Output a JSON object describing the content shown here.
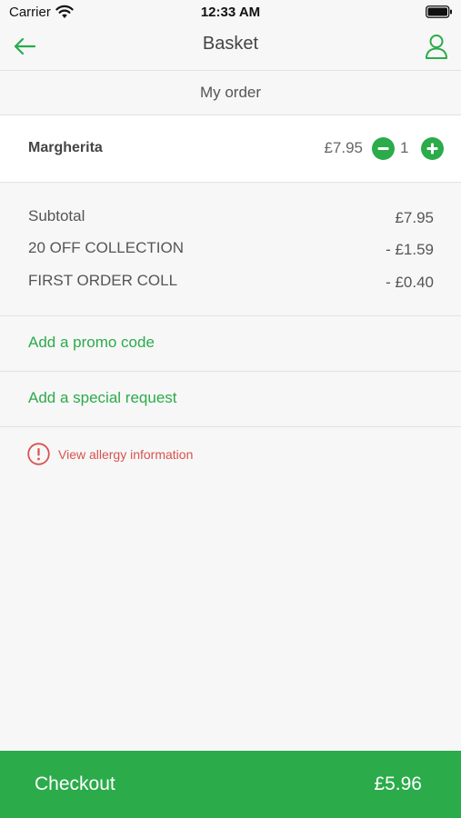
{
  "status_bar": {
    "carrier": "Carrier",
    "time": "12:33 AM"
  },
  "nav": {
    "title": "Basket",
    "back_icon": "arrow-left-icon",
    "profile_icon": "user-icon"
  },
  "section": {
    "header": "My order"
  },
  "basket": {
    "items": [
      {
        "name": "Margherita",
        "price": "£7.95",
        "quantity": "1"
      }
    ]
  },
  "totals": {
    "lines": [
      {
        "label": "Subtotal",
        "value": "£7.95"
      },
      {
        "label": "20 OFF COLLECTION",
        "value": "- £1.59"
      },
      {
        "label": "FIRST ORDER COLL",
        "value": "- £0.40"
      }
    ]
  },
  "actions": {
    "promo_label": "Add a promo code",
    "request_label": "Add a special request",
    "allergy_label": "View allergy information"
  },
  "checkout": {
    "label": "Checkout",
    "total": "£5.96"
  },
  "colors": {
    "accent": "#2bab4a",
    "warning": "#d9534f",
    "background": "#f7f7f7"
  }
}
